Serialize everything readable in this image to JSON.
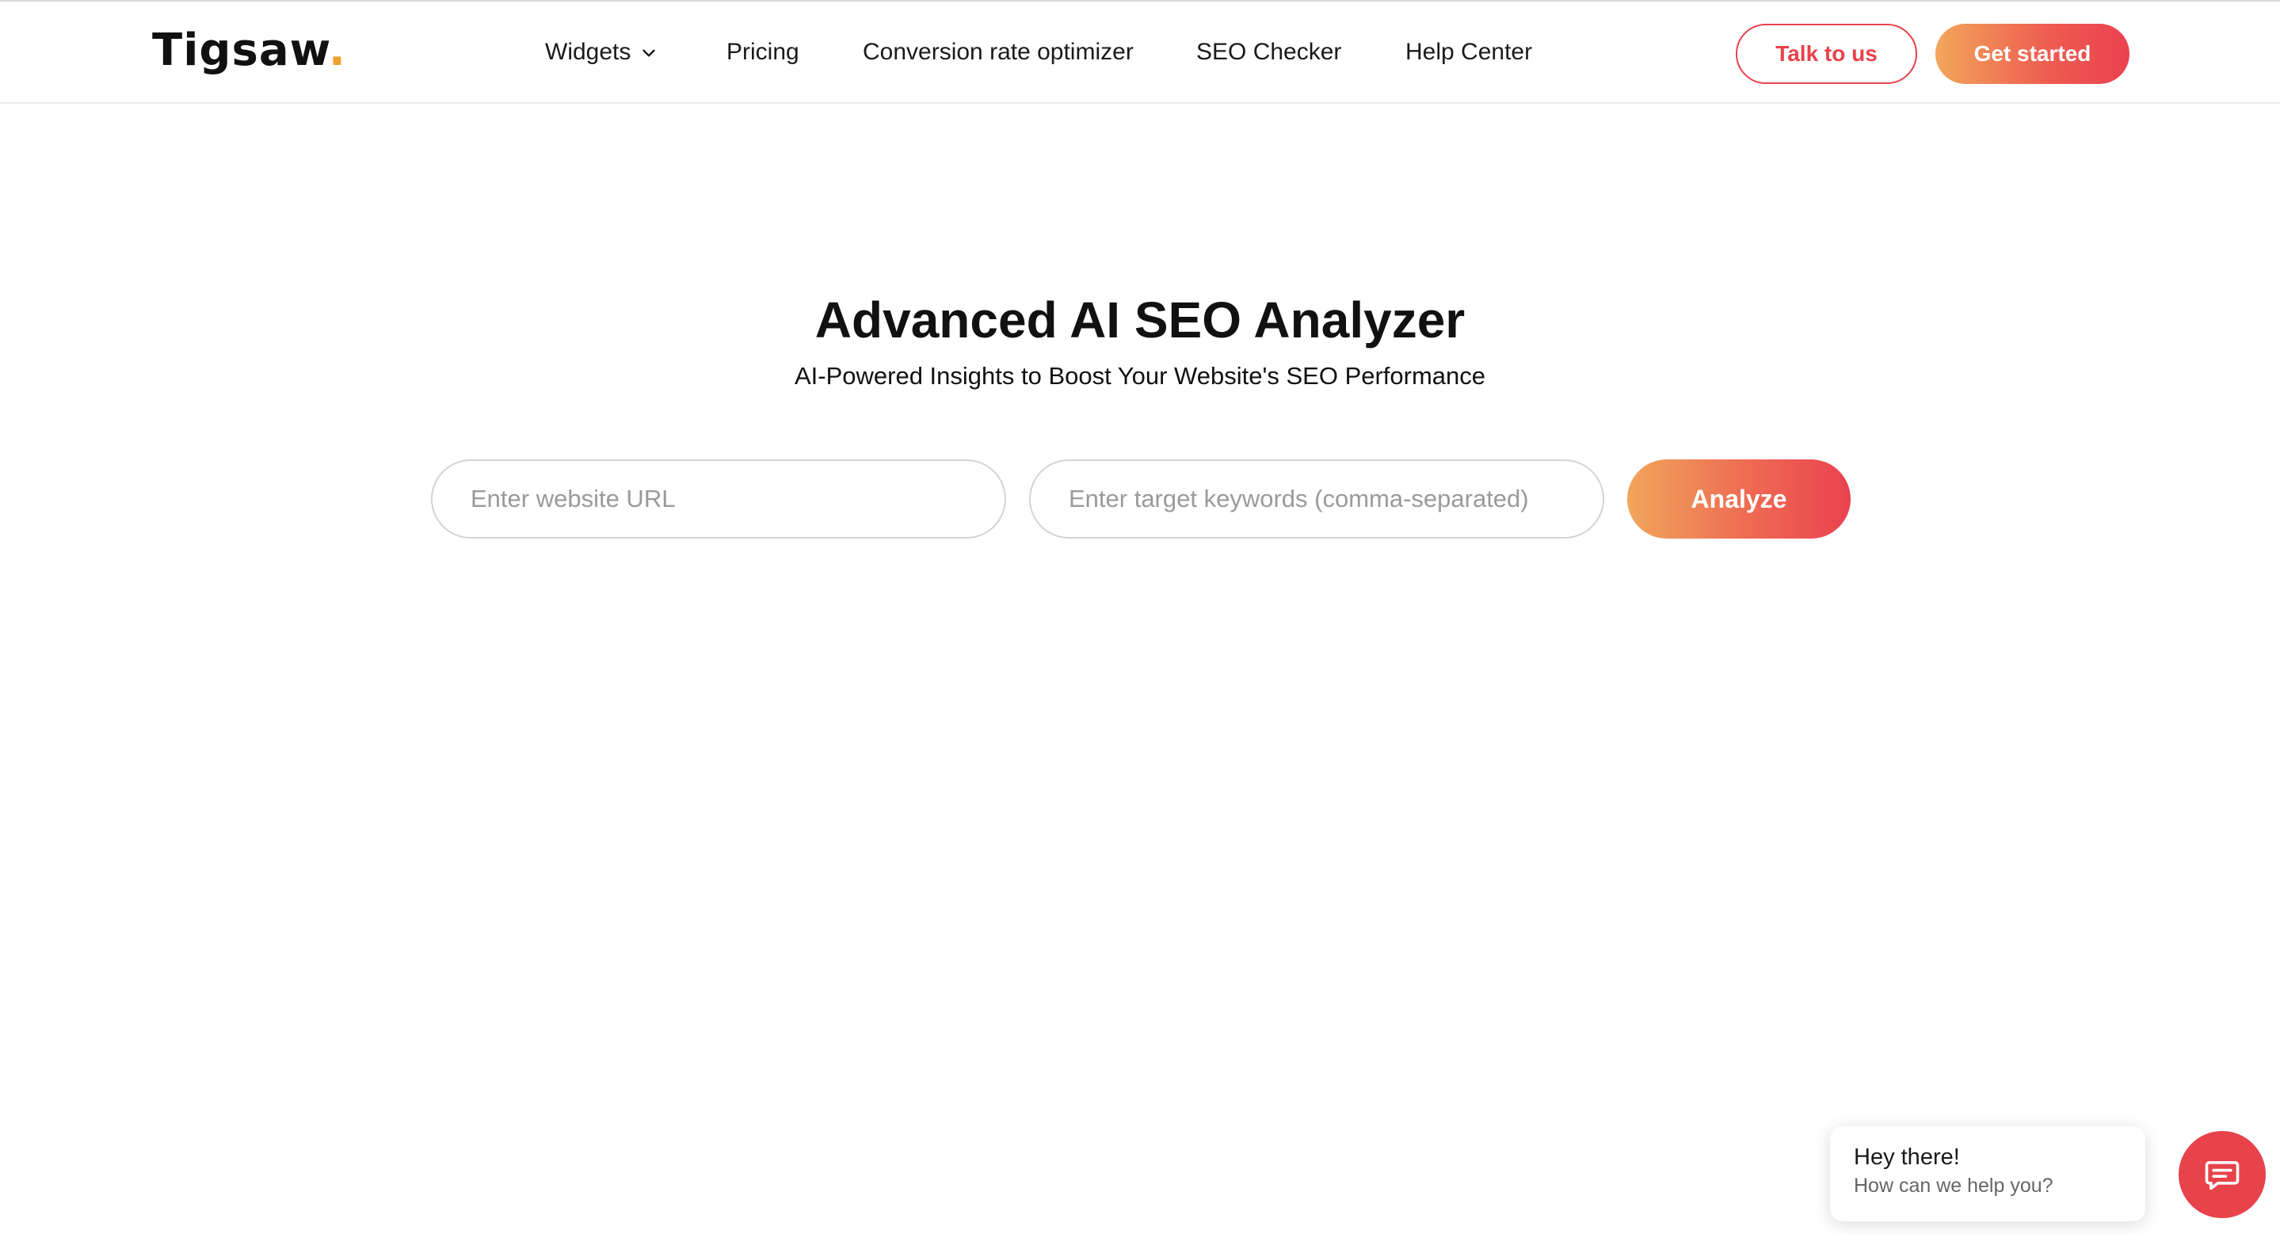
{
  "brand": {
    "name": "Tigsaw",
    "dot": ".",
    "accent_color": "#f0a030"
  },
  "nav": {
    "widgets": "Widgets",
    "pricing": "Pricing",
    "conversion": "Conversion rate optimizer",
    "seo_checker": "SEO Checker",
    "help_center": "Help Center"
  },
  "header_actions": {
    "talk": "Talk to us",
    "get_started": "Get started"
  },
  "hero": {
    "title": "Advanced AI SEO Analyzer",
    "subtitle": "AI-Powered Insights to Boost Your Website's SEO Performance"
  },
  "form": {
    "url_placeholder": "Enter website URL",
    "keywords_placeholder": "Enter target keywords (comma-separated)",
    "analyze": "Analyze"
  },
  "chat": {
    "title": "Hey there!",
    "text": "How can we help you?",
    "icon": "chat-icon"
  },
  "colors": {
    "primary_red": "#e8424a",
    "gradient_start": "#f2a65a",
    "gradient_end": "#ea4250"
  }
}
